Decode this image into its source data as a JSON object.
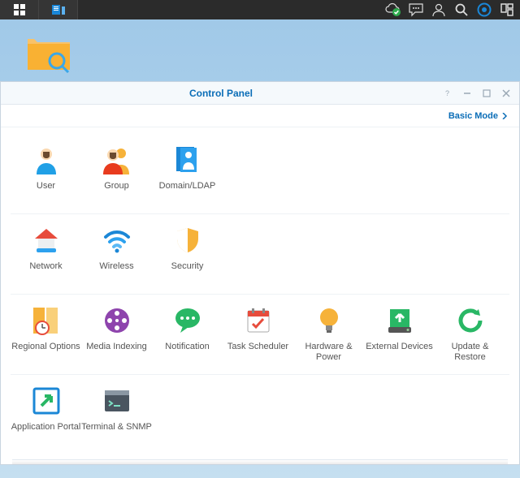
{
  "topbar": {
    "left_buttons": [
      "apps-icon",
      "server-icon"
    ],
    "right_icons": [
      "cloud-ok-icon",
      "chat-icon",
      "user-icon",
      "search-icon",
      "activity-icon",
      "widgets-icon"
    ]
  },
  "desktop": {
    "file_station_label": ""
  },
  "window": {
    "title": "Control Panel",
    "mode_link": "Basic Mode",
    "sections": [
      [
        {
          "key": "user",
          "label": "User"
        },
        {
          "key": "group",
          "label": "Group"
        },
        {
          "key": "domain",
          "label": "Domain/LDAP"
        }
      ],
      [
        {
          "key": "network",
          "label": "Network"
        },
        {
          "key": "wireless",
          "label": "Wireless"
        },
        {
          "key": "security",
          "label": "Security"
        }
      ],
      [
        {
          "key": "regional",
          "label": "Regional Options"
        },
        {
          "key": "mediaindexing",
          "label": "Media Indexing"
        },
        {
          "key": "notification",
          "label": "Notification"
        },
        {
          "key": "taskscheduler",
          "label": "Task Scheduler"
        },
        {
          "key": "hardware",
          "label": "Hardware & Power"
        },
        {
          "key": "external",
          "label": "External Devices"
        },
        {
          "key": "update",
          "label": "Update & Restore"
        }
      ],
      [
        {
          "key": "appportal",
          "label": "Application Portal"
        },
        {
          "key": "terminal",
          "label": "Terminal & SNMP"
        }
      ]
    ]
  }
}
